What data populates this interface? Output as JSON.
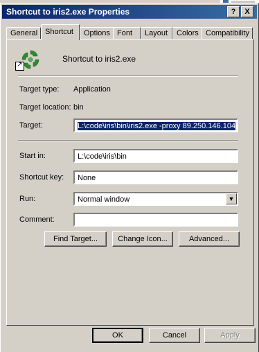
{
  "window": {
    "title": "Shortcut to iris2.exe Properties"
  },
  "titlebar_buttons": {
    "help": "?",
    "close": "X"
  },
  "tabs": [
    {
      "label": "General"
    },
    {
      "label": "Shortcut"
    },
    {
      "label": "Options"
    },
    {
      "label": "Font"
    },
    {
      "label": "Layout"
    },
    {
      "label": "Colors"
    },
    {
      "label": "Compatibility"
    }
  ],
  "shortcut": {
    "name": "Shortcut to iris2.exe",
    "target_type_label": "Target type:",
    "target_type": "Application",
    "target_location_label": "Target location:",
    "target_location": "bin",
    "target_label": "Target:",
    "target": "L:\\code\\iris\\bin\\iris2.exe -proxy 89.250.146.104",
    "start_in_label": "Start in:",
    "start_in": "L:\\code\\iris\\bin",
    "shortcut_key_label": "Shortcut key:",
    "shortcut_key": "None",
    "run_label": "Run:",
    "run": "Normal window",
    "comment_label": "Comment:",
    "comment": "",
    "find_target": "Find Target...",
    "change_icon": "Change Icon...",
    "advanced": "Advanced..."
  },
  "footer": {
    "ok": "OK",
    "cancel": "Cancel",
    "apply": "Apply"
  },
  "colors": {
    "titlebar": "#0a246a",
    "selection": "#0a246a",
    "app_icon": "#2f8a2f"
  },
  "icons": {
    "app": "green-swirl-icon",
    "shortcut_overlay": "shortcut-arrow-icon"
  }
}
